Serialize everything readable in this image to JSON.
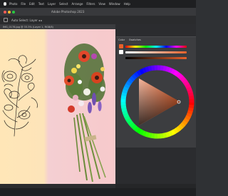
{
  "os_menu": {
    "items": [
      "Photo",
      "File",
      "Edit",
      "Text",
      "Layer",
      "Select",
      "Arrange",
      "Filters",
      "View",
      "Window",
      "Help"
    ],
    "clock": ""
  },
  "window": {
    "title": "Adobe Photoshop 2023"
  },
  "toolbar": {
    "text": "  Auto  Select:  Layer  ◂  ▸"
  },
  "document": {
    "tab_label": "IMG_0178.jpg @ 33.3% (Layer 1, RGB/8)"
  },
  "panel": {
    "tabs": [
      "Color",
      "Swatches"
    ]
  },
  "colors": {
    "app_bg": "#2f3134",
    "accent_current": "#e8612a",
    "canvas_left": "#ffe6b7",
    "canvas_right": "#f7c9cb"
  },
  "status": {
    "text": ""
  }
}
